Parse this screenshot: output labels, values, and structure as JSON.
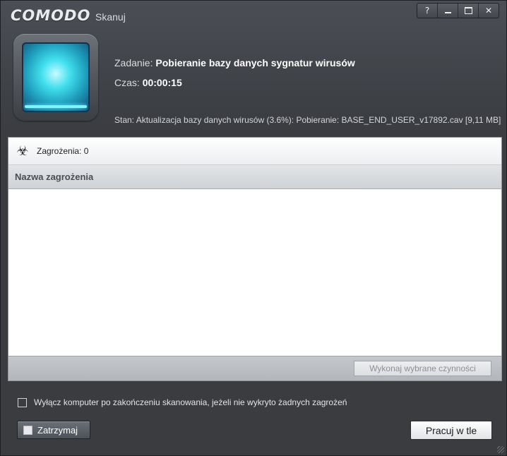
{
  "window": {
    "brand": "COMODO",
    "title": "Skanuj",
    "controls": {
      "help": "?",
      "minimize": "",
      "maximize": "",
      "close": "✕"
    }
  },
  "scan": {
    "icon": "scanner-icon",
    "task_label": "Zadanie:",
    "task_value": "Pobieranie bazy danych sygnatur wirusów",
    "time_label": "Czas:",
    "time_value": "00:00:15",
    "status_text": "Stan: Aktualizacja bazy danych wirusów (3.6%): Pobieranie: BASE_END_USER_v17892.cav [9,11 MB]",
    "progress_percent": 3.6
  },
  "threats": {
    "icon": "biohazard-icon",
    "count_label": "Zagrożenia: 0",
    "column_header": "Nazwa zagrożenia",
    "rows": [],
    "action_button": "Wykonaj wybrane czynności"
  },
  "options": {
    "shutdown_label": "Wyłącz komputer po zakończeniu skanowania, jeżeli nie wykryto żadnych zagrożeń",
    "shutdown_checked": false
  },
  "buttons": {
    "stop": "Zatrzymaj",
    "background": "Pracuj w tle"
  },
  "colors": {
    "window_bg": "#3f4247",
    "scanner_accent": "#41e0ee"
  }
}
